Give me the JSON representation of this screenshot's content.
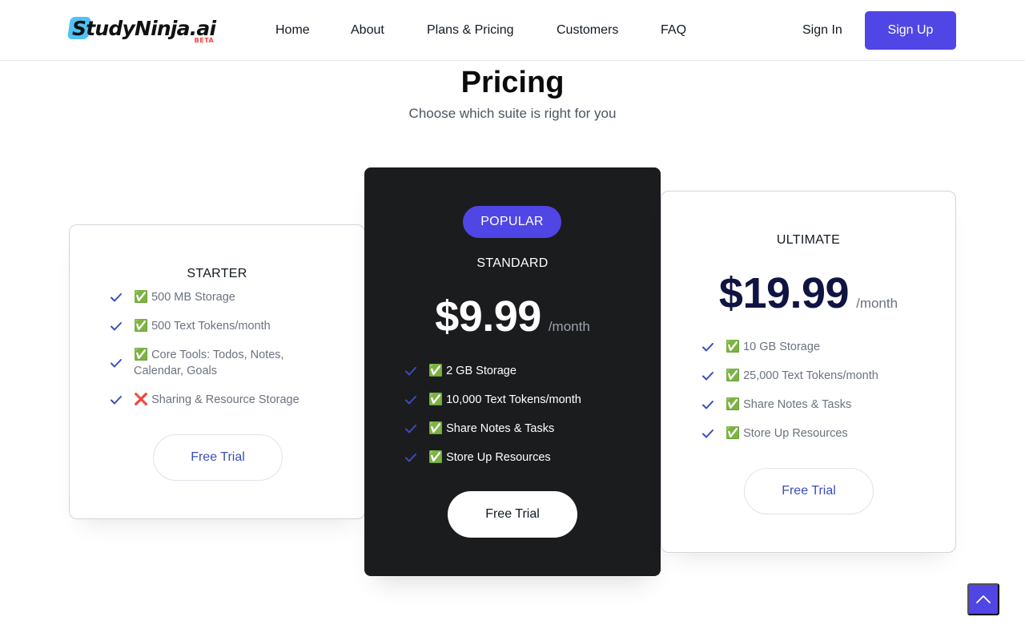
{
  "header": {
    "logo_text": "StudyNinja.ai",
    "logo_badge": "BETA",
    "nav": [
      {
        "label": "Home"
      },
      {
        "label": "About"
      },
      {
        "label": "Plans & Pricing"
      },
      {
        "label": "Customers"
      },
      {
        "label": "FAQ"
      }
    ],
    "sign_in": "Sign In",
    "sign_up": "Sign Up"
  },
  "pricing": {
    "title": "Pricing",
    "subtitle": "Choose which suite is right for you"
  },
  "plans": [
    {
      "name": "STARTER",
      "features": [
        "✅ 500 MB Storage",
        "✅ 500 Text Tokens/month",
        "✅ Core Tools: Todos, Notes, Calendar, Goals",
        "❌ Sharing & Resource Storage"
      ],
      "cta": "Free Trial"
    },
    {
      "badge": "POPULAR",
      "name": "STANDARD",
      "price": "$9.99",
      "period": "/month",
      "features": [
        "✅ 2 GB Storage",
        "✅ 10,000 Text Tokens/month",
        "✅ Share Notes & Tasks",
        "✅ Store Up Resources"
      ],
      "cta": "Free Trial"
    },
    {
      "name": "ULTIMATE",
      "price": "$19.99",
      "period": "/month",
      "features": [
        "✅ 10 GB Storage",
        "✅ 25,000 Text Tokens/month",
        "✅ Share Notes & Tasks",
        "✅ Store Up Resources"
      ],
      "cta": "Free Trial"
    }
  ],
  "icons": {
    "feature_check": "check-icon",
    "scroll_top": "chevron-up-icon"
  },
  "colors": {
    "accent": "#5046e5",
    "check": "#3b4ebb",
    "dark_card": "#1b1c1e"
  }
}
